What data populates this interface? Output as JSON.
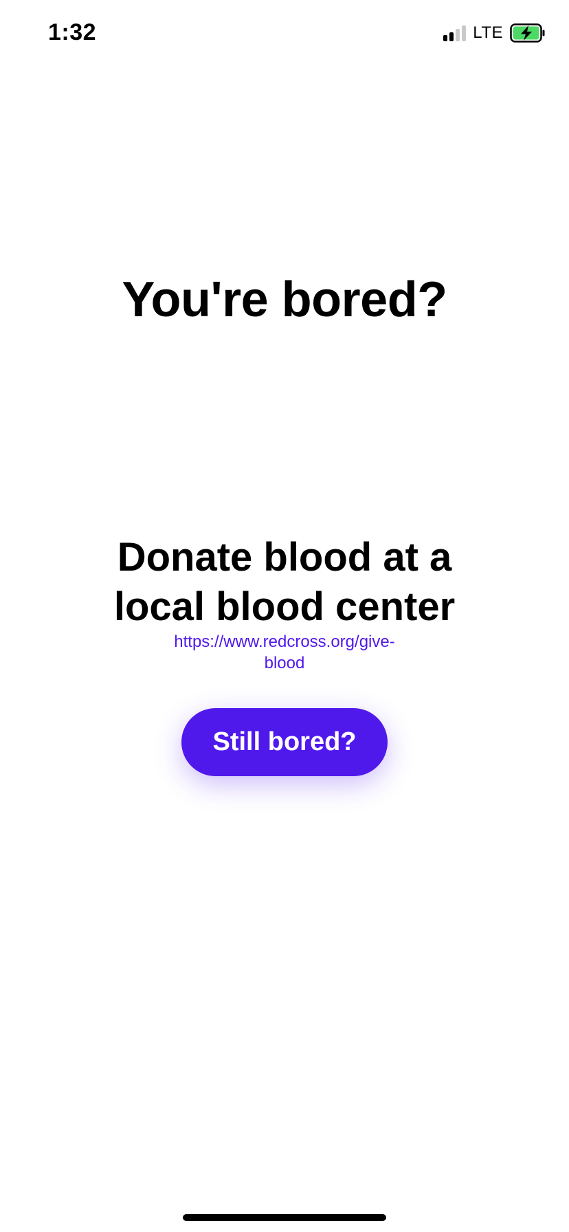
{
  "status_bar": {
    "time": "1:32",
    "network": "LTE",
    "signal_bars_active": 2,
    "signal_bars_total": 4,
    "battery_state": "charging",
    "battery_color": "#4CD964"
  },
  "main": {
    "title": "You're bored?",
    "activity_lines": [
      "Donate blood at a",
      "local blood center"
    ],
    "link_lines": [
      "https://www.redcross.org/give-",
      "blood"
    ],
    "button_label": "Still bored?"
  },
  "colors": {
    "accent": "#5019EC",
    "background": "#FFFFFF",
    "text": "#000000"
  },
  "icons": {
    "signal": "cellular-signal-icon",
    "battery": "battery-charging-icon"
  }
}
